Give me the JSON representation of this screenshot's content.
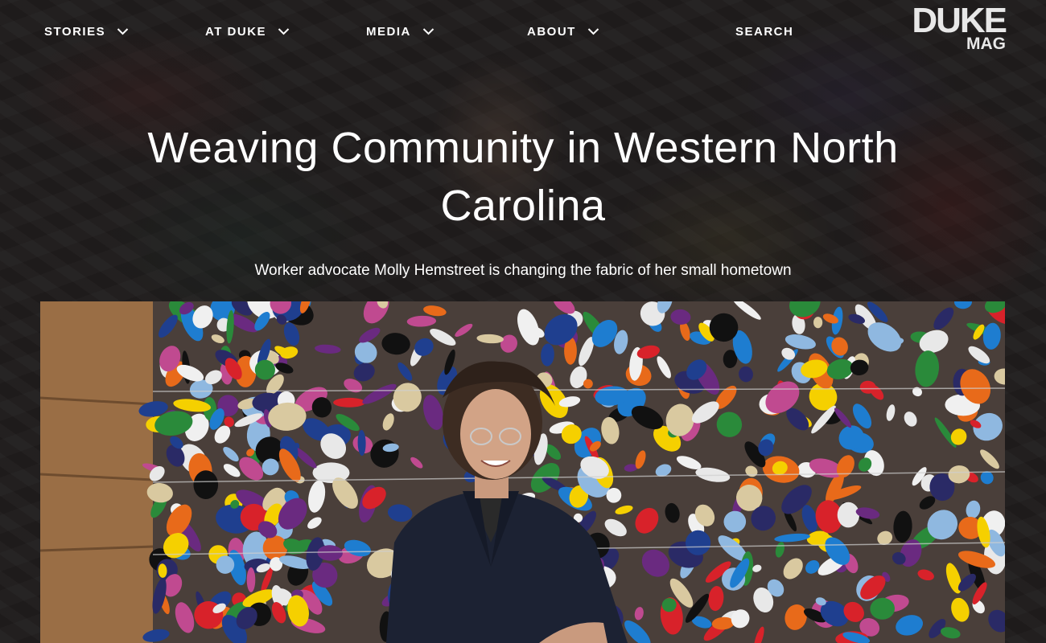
{
  "nav": {
    "items": [
      {
        "label": "STORIES",
        "has_dropdown": true
      },
      {
        "label": "AT DUKE",
        "has_dropdown": true
      },
      {
        "label": "MEDIA",
        "has_dropdown": true
      },
      {
        "label": "ABOUT",
        "has_dropdown": true
      }
    ],
    "search_label": "SEARCH"
  },
  "logo": {
    "line1": "DUKE",
    "line2": "MAG"
  },
  "article": {
    "title_line1": "Weaving Community in Western North",
    "title_line2": "Carolina",
    "dek": "Worker advocate Molly Hemstreet is changing the fabric of her small hometown"
  },
  "icons": {
    "dropdown": "chevron-down-icon"
  },
  "colors": {
    "background": "#2a2626",
    "text": "#ffffff",
    "logo": "#e8e8e8"
  }
}
